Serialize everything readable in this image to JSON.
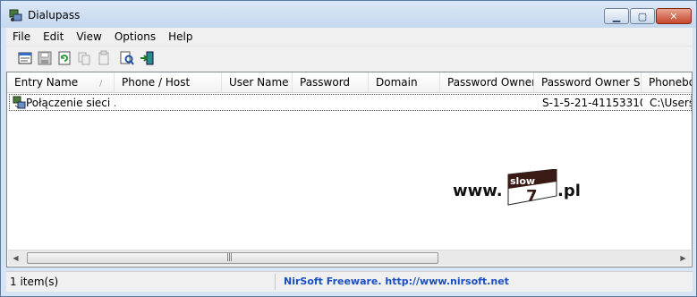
{
  "window": {
    "title": "Dialupass",
    "min_glyph": "▁",
    "max_glyph": "▢",
    "close_glyph": "✕"
  },
  "menu": [
    "File",
    "Edit",
    "View",
    "Options",
    "Help"
  ],
  "toolbar_icons": [
    "properties-icon",
    "save-icon",
    "refresh-icon",
    "copy-icon",
    "copy-text-icon",
    "find-icon",
    "exit-icon"
  ],
  "columns": [
    "Entry Name",
    "Phone / Host",
    "User Name",
    "Password",
    "Domain",
    "Password Owner",
    "Password Owner SID",
    "Phonebo"
  ],
  "sort_indicator": "/",
  "rows": [
    {
      "entry_name": "Połączenie sieci ...",
      "phone_host": "",
      "user_name": "",
      "password": "",
      "domain": "",
      "password_owner": "",
      "password_owner_sid": "S-1-5-21-41153310...",
      "phonebook": "C:\\Users\\"
    }
  ],
  "scrollbar": {
    "left_arrow": "◀",
    "right_arrow": "▶",
    "grip": "|||"
  },
  "watermark": {
    "prefix": "www.",
    "box_top": "slow",
    "box_bottom": "7",
    "suffix": ".pl",
    "colors": {
      "dark": "#3a1a14",
      "text": "#111111"
    }
  },
  "status": {
    "items": "1 item(s)",
    "link": "NirSoft Freeware.  http://www.nirsoft.net",
    "link_color": "#1a4fc0"
  }
}
